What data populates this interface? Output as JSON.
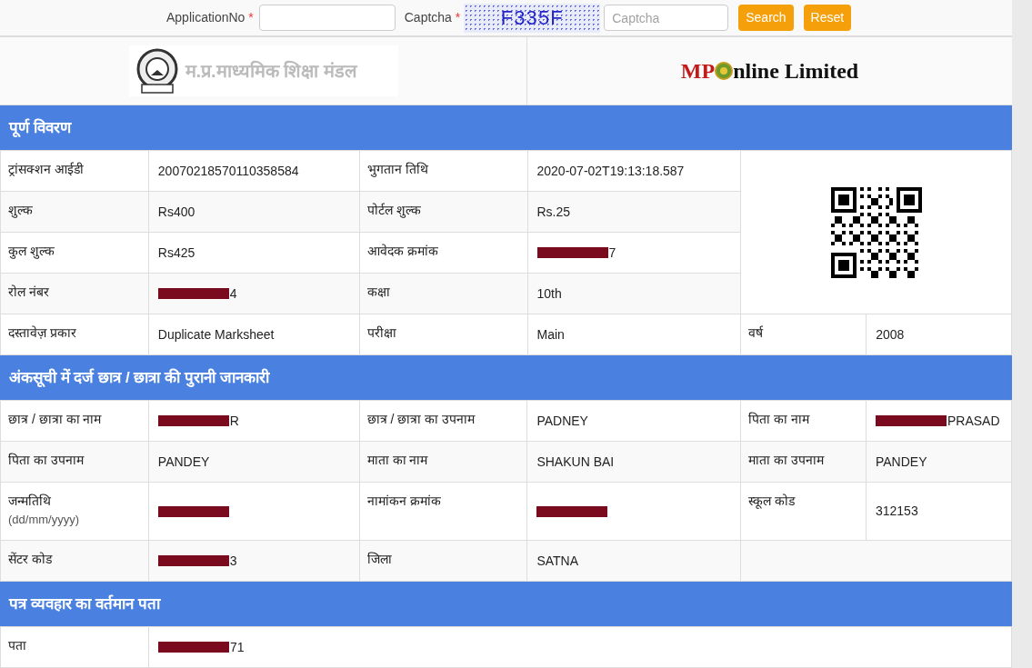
{
  "search_bar": {
    "application_label": "ApplicationNo",
    "captcha_label": "Captcha",
    "required_mark": "*",
    "captcha_code": "F335F",
    "captcha_placeholder": "Captcha",
    "buttons": [
      "Search",
      "Reset"
    ]
  },
  "header": {
    "board_name": "म.प्र.माध्यमिक शिक्षा मंडल",
    "brand_prefix": "MP",
    "brand_rest": "nline Limited"
  },
  "sections": [
    {
      "title": "पूर्ण विवरण",
      "qr_code": true,
      "rows": [
        {
          "fields": [
            {
              "label": "ट्रांसक्शन आईडी",
              "value": "20070218570110358584"
            },
            {
              "label": "भुगतान तिथि",
              "value": "2020-07-02T19:13:18.587"
            }
          ]
        },
        {
          "fields": [
            {
              "label": "शुल्क",
              "value": "Rs400"
            },
            {
              "label": "पोर्टल शुल्क",
              "value": "Rs.25"
            }
          ]
        },
        {
          "fields": [
            {
              "label": "कुल शुल्क",
              "value": "Rs425"
            },
            {
              "label": "आवेदक क्रमांक",
              "value": "7",
              "redacted": true
            }
          ]
        },
        {
          "fields": [
            {
              "label": "रोल नंबर",
              "value": "4",
              "redacted": true
            },
            {
              "label": "कक्षा",
              "value": "10th"
            }
          ]
        },
        {
          "fields": [
            {
              "label": "दस्तावेज़ प्रकार",
              "value": "Duplicate Marksheet"
            },
            {
              "label": "परीक्षा",
              "value": "Main"
            },
            {
              "label": "वर्ष",
              "value": "2008"
            }
          ]
        }
      ]
    },
    {
      "title": "अंकसूची में दर्ज छात्र / छात्रा की पुरानी जानकारी",
      "rows": [
        {
          "fields": [
            {
              "label": "छात्र / छात्रा का नाम",
              "value": "R",
              "redacted": true
            },
            {
              "label": "छात्र / छात्रा का उपनाम",
              "value": "PADNEY"
            },
            {
              "label": "पिता का नाम",
              "value": "PRASAD",
              "redacted": true
            }
          ]
        },
        {
          "fields": [
            {
              "label": "पिता का उपनाम",
              "value": "PANDEY"
            },
            {
              "label": "माता का नाम",
              "value": "SHAKUN BAI"
            },
            {
              "label": "माता का उपनाम",
              "value": "PANDEY"
            }
          ]
        },
        {
          "fields": [
            {
              "label": "जन्मतिथि",
              "hint": "(dd/mm/yyyy)",
              "redacted": true
            },
            {
              "label": "नामांकन क्रमांक",
              "redacted": true
            },
            {
              "label": "स्कूल कोड",
              "value": "312153"
            }
          ]
        },
        {
          "fields": [
            {
              "label": "सेंटर कोड",
              "value": "3",
              "redacted": true
            },
            {
              "label": "जिला",
              "value": "SATNA"
            }
          ]
        }
      ]
    },
    {
      "title": "पत्र व्यवहार का वर्तमान पता",
      "rows": [
        {
          "fields": [
            {
              "label": "पता",
              "value": "71",
              "redacted": true
            }
          ]
        }
      ]
    }
  ]
}
